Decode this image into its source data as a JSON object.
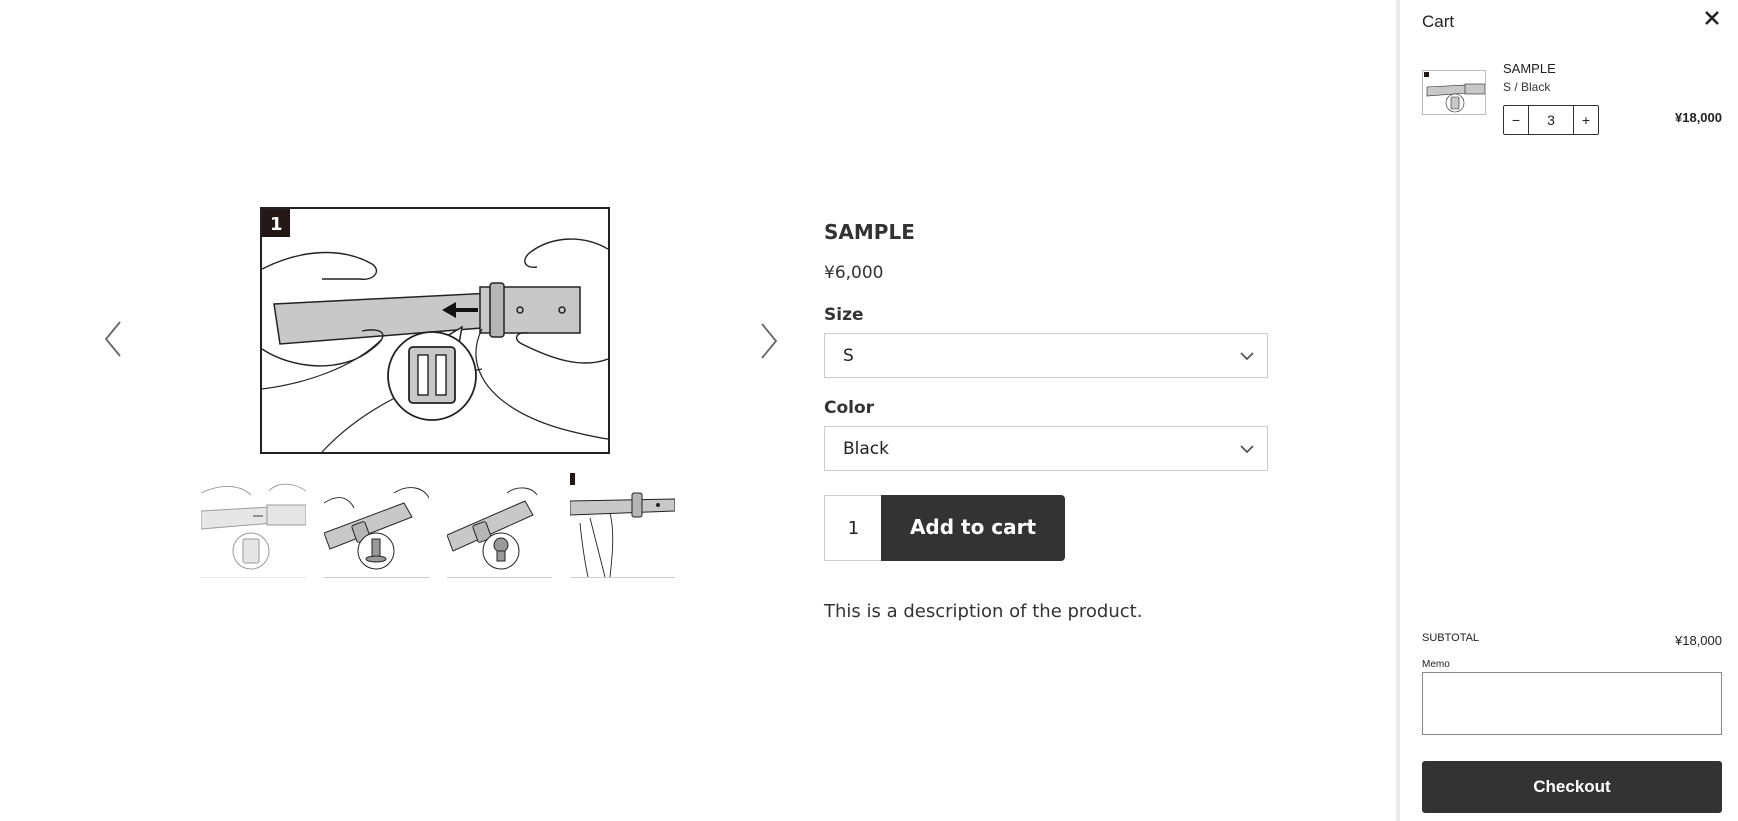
{
  "product": {
    "title": "SAMPLE",
    "price": "¥6,000",
    "size_label": "Size",
    "size_value": "S",
    "color_label": "Color",
    "color_value": "Black",
    "quantity": "1",
    "add_to_cart": "Add to cart",
    "description": "This is a description of the product.",
    "main_image_step": "1"
  },
  "gallery": {
    "prev_icon": "chevron-left-icon",
    "next_icon": "chevron-right-icon",
    "thumbnails": [
      "step-1",
      "step-2",
      "step-3",
      "step-4"
    ]
  },
  "cart": {
    "title": "Cart",
    "close_icon": "close-icon",
    "item": {
      "name": "SAMPLE",
      "variant": "S / Black",
      "minus": "−",
      "quantity": "3",
      "plus": "+",
      "price": "¥18,000"
    },
    "subtotal_label": "SUBTOTAL",
    "subtotal_value": "¥18,000",
    "memo_label": "Memo",
    "memo_value": "",
    "checkout": "Checkout"
  },
  "colors": {
    "dark_button": "#333333",
    "border": "#cccccc",
    "panel_divider": "#ececec"
  }
}
